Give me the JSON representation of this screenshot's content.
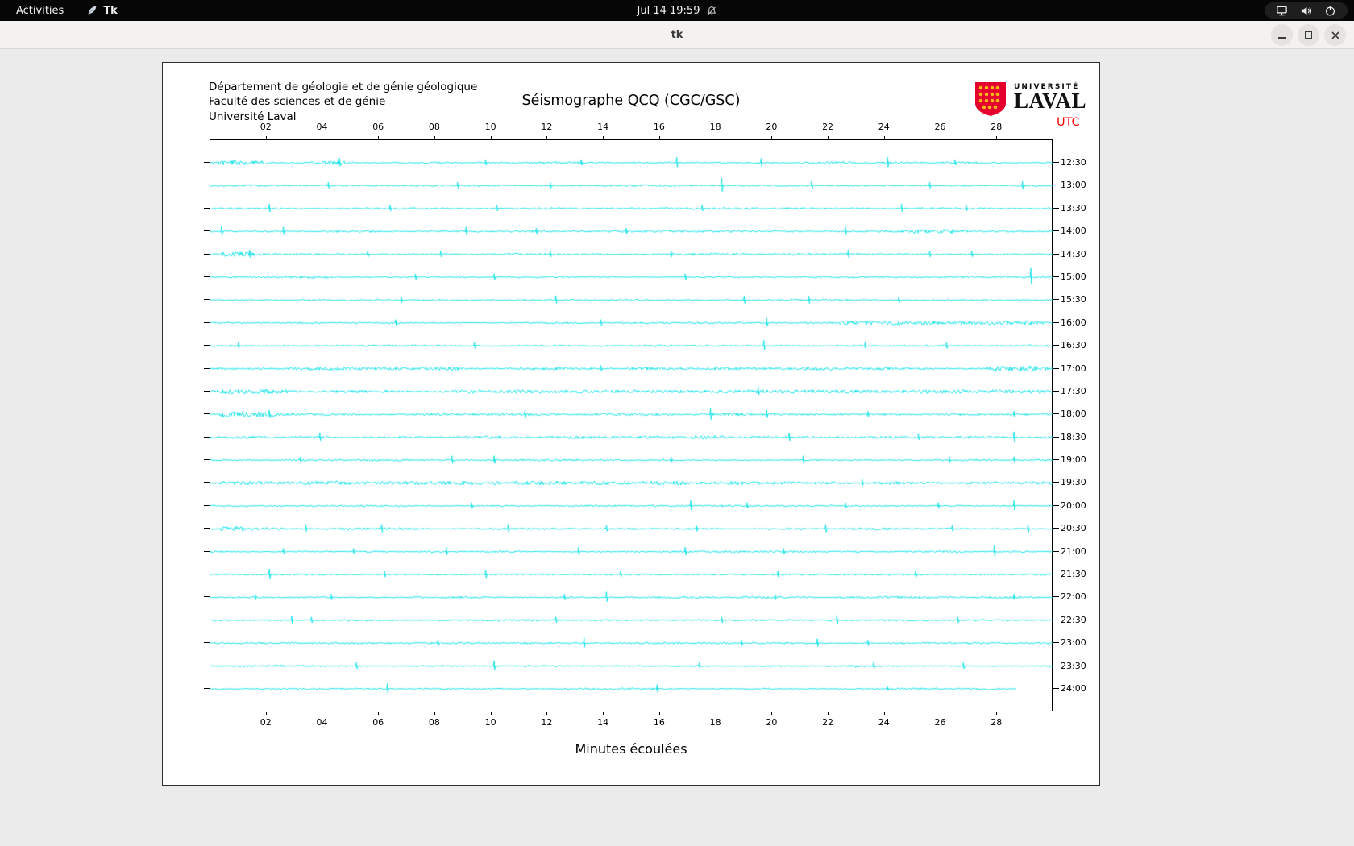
{
  "colors": {
    "trace": "#00E0E4",
    "utc": "#FF0000",
    "logo_red": "#E4012E",
    "logo_gold": "#FFB71B"
  },
  "top_bar": {
    "activities_label": "Activities",
    "app_name": "Tk",
    "clock": "Jul 14 19:59"
  },
  "title_bar": {
    "title": "tk"
  },
  "panel": {
    "header_lines": [
      "Département de géologie et de génie géologique",
      "Faculté des sciences et de génie",
      "Université Laval"
    ],
    "title": "Séismographe QCQ (CGC/GSC)",
    "utc_label": "UTC",
    "xlabel": "Minutes écoulées",
    "logo": {
      "top": "UNIVERSITÉ",
      "bottom": "LAVAL"
    }
  },
  "chart_data": {
    "type": "line",
    "title": "Séismographe QCQ (CGC/GSC)",
    "xlabel": "Minutes écoulées",
    "x_range": [
      0,
      30
    ],
    "x_tick_labels": [
      "02",
      "04",
      "06",
      "08",
      "10",
      "12",
      "14",
      "16",
      "18",
      "20",
      "22",
      "24",
      "26",
      "28"
    ],
    "y_axis_side": "right",
    "grid": false,
    "rows": [
      {
        "label": "12:30",
        "base": 1.2,
        "bursts": [
          [
            0,
            2.3,
            2.6
          ],
          [
            3.3,
            5.2,
            2.2
          ]
        ],
        "spikes": [
          [
            4.6,
            4
          ],
          [
            9.8,
            3
          ],
          [
            13.2,
            3
          ],
          [
            16.6,
            5
          ],
          [
            19.6,
            4
          ],
          [
            24.1,
            5
          ],
          [
            26.5,
            3
          ]
        ]
      },
      {
        "label": "13:00",
        "base": 1.0,
        "bursts": [],
        "spikes": [
          [
            4.2,
            3
          ],
          [
            8.8,
            3
          ],
          [
            12.1,
            3
          ],
          [
            18.2,
            7
          ],
          [
            21.4,
            4
          ],
          [
            25.6,
            3
          ],
          [
            28.9,
            4
          ]
        ]
      },
      {
        "label": "13:30",
        "base": 0.9,
        "bursts": [],
        "spikes": [
          [
            2.1,
            4
          ],
          [
            6.4,
            3
          ],
          [
            10.2,
            3
          ],
          [
            17.5,
            3
          ],
          [
            24.6,
            4
          ],
          [
            26.9,
            3
          ]
        ]
      },
      {
        "label": "14:00",
        "base": 1.0,
        "bursts": [
          [
            24.6,
            27.2,
            2.6
          ]
        ],
        "spikes": [
          [
            0.4,
            5
          ],
          [
            2.6,
            4
          ],
          [
            9.1,
            4
          ],
          [
            11.6,
            3
          ],
          [
            14.8,
            3
          ],
          [
            22.6,
            4
          ]
        ]
      },
      {
        "label": "14:30",
        "base": 1.1,
        "bursts": [
          [
            0,
            1.8,
            2.8
          ]
        ],
        "spikes": [
          [
            1.4,
            4
          ],
          [
            5.6,
            3
          ],
          [
            8.2,
            3
          ],
          [
            12.1,
            3
          ],
          [
            16.4,
            3
          ],
          [
            22.7,
            4
          ],
          [
            25.6,
            3
          ],
          [
            27.1,
            3
          ]
        ]
      },
      {
        "label": "15:00",
        "base": 0.9,
        "bursts": [
          [
            2.4,
            4.6,
            1.8
          ]
        ],
        "spikes": [
          [
            7.3,
            3
          ],
          [
            10.1,
            3
          ],
          [
            16.9,
            3
          ],
          [
            29.2,
            8
          ]
        ]
      },
      {
        "label": "15:30",
        "base": 0.9,
        "bursts": [],
        "spikes": [
          [
            6.8,
            3
          ],
          [
            12.3,
            4
          ],
          [
            19.0,
            4
          ],
          [
            21.3,
            4
          ],
          [
            24.5,
            3
          ]
        ]
      },
      {
        "label": "16:00",
        "base": 0.9,
        "bursts": [
          [
            22.0,
            30,
            2.2
          ]
        ],
        "spikes": [
          [
            6.6,
            3
          ],
          [
            13.9,
            3
          ],
          [
            19.8,
            4
          ]
        ]
      },
      {
        "label": "16:30",
        "base": 0.9,
        "bursts": [],
        "spikes": [
          [
            1.0,
            3
          ],
          [
            9.4,
            3
          ],
          [
            19.7,
            5
          ],
          [
            23.3,
            3
          ],
          [
            26.2,
            3
          ]
        ]
      },
      {
        "label": "17:00",
        "base": 1.3,
        "bursts": [
          [
            2.4,
            9.2,
            2.2
          ],
          [
            14.5,
            16,
            1.8
          ],
          [
            20.8,
            23.2,
            2.2
          ],
          [
            27.4,
            30,
            3.2
          ]
        ],
        "spikes": [
          [
            13.9,
            3
          ]
        ]
      },
      {
        "label": "17:30",
        "base": 1.7,
        "bursts": [
          [
            0,
            3.2,
            2.6
          ],
          [
            9.8,
            17.2,
            2.0
          ],
          [
            19.2,
            21,
            1.8
          ],
          [
            24.8,
            30,
            2.6
          ]
        ],
        "spikes": [
          [
            19.5,
            4
          ]
        ]
      },
      {
        "label": "18:00",
        "base": 1.2,
        "bursts": [
          [
            0,
            2.6,
            3.0
          ]
        ],
        "spikes": [
          [
            2.1,
            4
          ],
          [
            11.2,
            4
          ],
          [
            17.8,
            6
          ],
          [
            19.8,
            4
          ],
          [
            23.4,
            3
          ],
          [
            28.6,
            3
          ]
        ]
      },
      {
        "label": "18:30",
        "base": 1.3,
        "bursts": [
          [
            8.8,
            11.2,
            2.2
          ],
          [
            16.8,
            18.6,
            2.6
          ]
        ],
        "spikes": [
          [
            3.9,
            4
          ],
          [
            20.6,
            4
          ],
          [
            25.2,
            3
          ],
          [
            28.6,
            5
          ]
        ]
      },
      {
        "label": "19:00",
        "base": 1.0,
        "bursts": [],
        "spikes": [
          [
            3.2,
            3
          ],
          [
            8.6,
            4
          ],
          [
            10.1,
            4
          ],
          [
            16.4,
            3
          ],
          [
            21.1,
            4
          ],
          [
            26.3,
            3
          ],
          [
            28.6,
            3
          ]
        ]
      },
      {
        "label": "19:30",
        "base": 1.5,
        "bursts": [
          [
            0,
            9.5,
            2.2
          ],
          [
            10.5,
            17.2,
            2.4
          ],
          [
            18.2,
            21.2,
            1.8
          ]
        ],
        "spikes": [
          [
            23.2,
            3
          ]
        ]
      },
      {
        "label": "20:00",
        "base": 0.9,
        "bursts": [],
        "spikes": [
          [
            9.3,
            3
          ],
          [
            17.1,
            5
          ],
          [
            19.1,
            3
          ],
          [
            22.6,
            3
          ],
          [
            25.9,
            3
          ],
          [
            28.6,
            5
          ]
        ]
      },
      {
        "label": "20:30",
        "base": 1.1,
        "bursts": [
          [
            0,
            1.6,
            2.6
          ]
        ],
        "spikes": [
          [
            3.4,
            3
          ],
          [
            6.1,
            4
          ],
          [
            10.6,
            4
          ],
          [
            14.1,
            3
          ],
          [
            17.3,
            3
          ],
          [
            21.9,
            4
          ],
          [
            26.4,
            3
          ],
          [
            29.1,
            4
          ]
        ]
      },
      {
        "label": "21:00",
        "base": 0.9,
        "bursts": [],
        "spikes": [
          [
            2.6,
            3
          ],
          [
            5.1,
            3
          ],
          [
            8.4,
            4
          ],
          [
            13.1,
            4
          ],
          [
            16.9,
            4
          ],
          [
            20.4,
            3
          ],
          [
            27.9,
            6
          ]
        ]
      },
      {
        "label": "21:30",
        "base": 0.9,
        "bursts": [],
        "spikes": [
          [
            2.1,
            5
          ],
          [
            6.2,
            3
          ],
          [
            9.8,
            4
          ],
          [
            14.6,
            3
          ],
          [
            20.2,
            3
          ],
          [
            25.1,
            3
          ]
        ]
      },
      {
        "label": "22:00",
        "base": 1.0,
        "bursts": [],
        "spikes": [
          [
            1.6,
            3
          ],
          [
            4.3,
            3
          ],
          [
            12.6,
            3
          ],
          [
            14.1,
            5
          ],
          [
            20.1,
            3
          ],
          [
            28.6,
            3
          ]
        ]
      },
      {
        "label": "22:30",
        "base": 0.9,
        "bursts": [],
        "spikes": [
          [
            2.9,
            4
          ],
          [
            3.6,
            3
          ],
          [
            12.3,
            3
          ],
          [
            18.2,
            3
          ],
          [
            22.3,
            5
          ],
          [
            26.6,
            3
          ]
        ]
      },
      {
        "label": "23:00",
        "base": 0.9,
        "bursts": [],
        "spikes": [
          [
            8.1,
            3
          ],
          [
            13.3,
            5
          ],
          [
            18.9,
            3
          ],
          [
            21.6,
            4
          ],
          [
            23.4,
            3
          ]
        ]
      },
      {
        "label": "23:30",
        "base": 0.9,
        "bursts": [],
        "spikes": [
          [
            5.2,
            3
          ],
          [
            10.1,
            5
          ],
          [
            17.4,
            3
          ],
          [
            23.6,
            3
          ],
          [
            26.8,
            3
          ]
        ]
      },
      {
        "label": "24:00",
        "base": 0.9,
        "end": 28.7,
        "bursts": [],
        "spikes": [
          [
            6.3,
            5
          ],
          [
            15.9,
            4
          ],
          [
            24.1,
            2
          ]
        ]
      }
    ]
  }
}
